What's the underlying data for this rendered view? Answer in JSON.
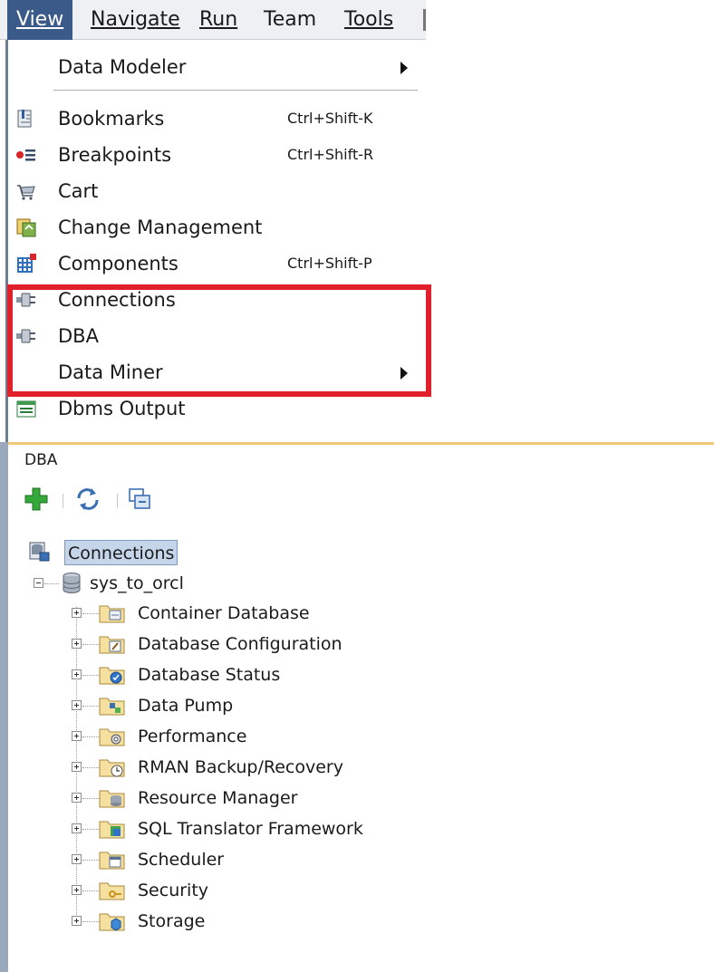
{
  "menubar": {
    "items": [
      {
        "label": "View",
        "active": true
      },
      {
        "label": "Navigate"
      },
      {
        "label": "Run"
      },
      {
        "label": "Team"
      },
      {
        "label": "Tools"
      }
    ]
  },
  "dropdown": {
    "items": [
      {
        "label": "Data Modeler",
        "shortcut": "",
        "submenu": true
      },
      {
        "label": "Bookmarks",
        "shortcut": "Ctrl+Shift-K",
        "icon": "bookmarks-icon"
      },
      {
        "label": "Breakpoints",
        "shortcut": "Ctrl+Shift-R",
        "icon": "breakpoints-icon"
      },
      {
        "label": "Cart",
        "shortcut": "",
        "icon": "cart-icon"
      },
      {
        "label": "Change Management",
        "shortcut": "",
        "icon": "change-management-icon"
      },
      {
        "label": "Components",
        "shortcut": "Ctrl+Shift-P",
        "icon": "components-icon"
      },
      {
        "label": "Connections",
        "shortcut": "",
        "icon": "connections-icon"
      },
      {
        "label": "DBA",
        "shortcut": "",
        "icon": "dba-icon"
      },
      {
        "label": "Data Miner",
        "shortcut": "",
        "submenu": true
      },
      {
        "label": "Dbms Output",
        "shortcut": "",
        "icon": "dbms-output-icon"
      }
    ]
  },
  "panel": {
    "title": "DBA",
    "tree": {
      "root": "Connections",
      "connection": "sys_to_orcl",
      "nodes": [
        {
          "label": "Container Database"
        },
        {
          "label": "Database Configuration"
        },
        {
          "label": "Database Status"
        },
        {
          "label": "Data Pump"
        },
        {
          "label": "Performance"
        },
        {
          "label": "RMAN Backup/Recovery"
        },
        {
          "label": "Resource Manager"
        },
        {
          "label": "SQL Translator Framework"
        },
        {
          "label": "Scheduler"
        },
        {
          "label": "Security"
        },
        {
          "label": "Storage"
        }
      ]
    }
  },
  "colors": {
    "menu_active": "#3a5a8a",
    "highlight_box": "#e0202a",
    "selection": "#c6d6ea"
  }
}
